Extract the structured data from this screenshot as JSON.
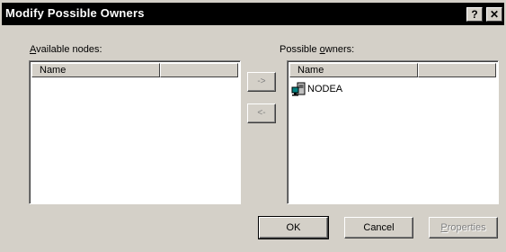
{
  "window": {
    "title": "Modify Possible Owners",
    "help_icon": "?",
    "close_icon": "✕"
  },
  "available": {
    "label_accel": "A",
    "label_rest": "vailable nodes:",
    "columns": [
      "Name",
      ""
    ],
    "items": []
  },
  "owners": {
    "label_pre": "Possible ",
    "label_accel": "o",
    "label_rest": "wners:",
    "columns": [
      "Name",
      ""
    ],
    "items": [
      {
        "name": "NODEA",
        "icon": "server-node-icon"
      }
    ]
  },
  "arrows": {
    "add": "->",
    "remove": "<-"
  },
  "buttons": {
    "ok": "OK",
    "cancel": "Cancel",
    "properties_accel": "P",
    "properties_rest": "roperties"
  }
}
